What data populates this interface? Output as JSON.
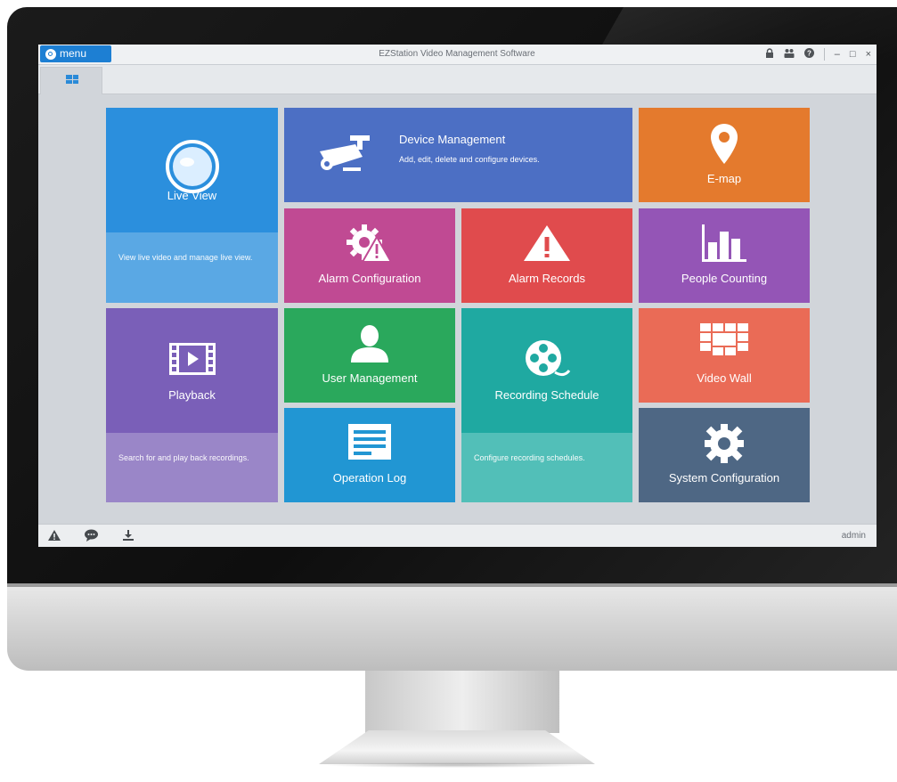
{
  "window": {
    "menu_label": "menu",
    "title": "EZStation Video Management Software",
    "controls": {
      "lock_icon": "🔒",
      "users_icon": "👥",
      "help_icon": "?",
      "minimize": "–",
      "maximize": "□",
      "close": "×"
    }
  },
  "tiles": {
    "live_view": {
      "label": "Live View",
      "desc": "View live video and manage live view.",
      "color": "#2b8fdd",
      "desc_color": "#5aa8e4"
    },
    "device_management": {
      "label": "Device Management",
      "desc": "Add, edit, delete and configure devices.",
      "color": "#4c6fc4"
    },
    "emap": {
      "label": "E-map",
      "color": "#e47a2d"
    },
    "alarm_configuration": {
      "label": "Alarm Configuration",
      "color": "#c04a93"
    },
    "alarm_records": {
      "label": "Alarm Records",
      "color": "#e04b4d"
    },
    "people_counting": {
      "label": "People Counting",
      "color": "#9455b6"
    },
    "playback": {
      "label": "Playback",
      "desc": "Search for and play back recordings.",
      "color": "#7a5fb8",
      "desc_color": "#9a86c8"
    },
    "user_management": {
      "label": "User Management",
      "color": "#2aa85c"
    },
    "recording_schedule": {
      "label": "Recording Schedule",
      "desc": "Configure recording schedules.",
      "color": "#1fa9a1",
      "desc_color": "#52bfb8"
    },
    "video_wall": {
      "label": "Video Wall",
      "color": "#ea6b56"
    },
    "operation_log": {
      "label": "Operation Log",
      "color": "#2196d3"
    },
    "system_configuration": {
      "label": "System Configuration",
      "color": "#4e6784"
    }
  },
  "status": {
    "user": "admin"
  }
}
